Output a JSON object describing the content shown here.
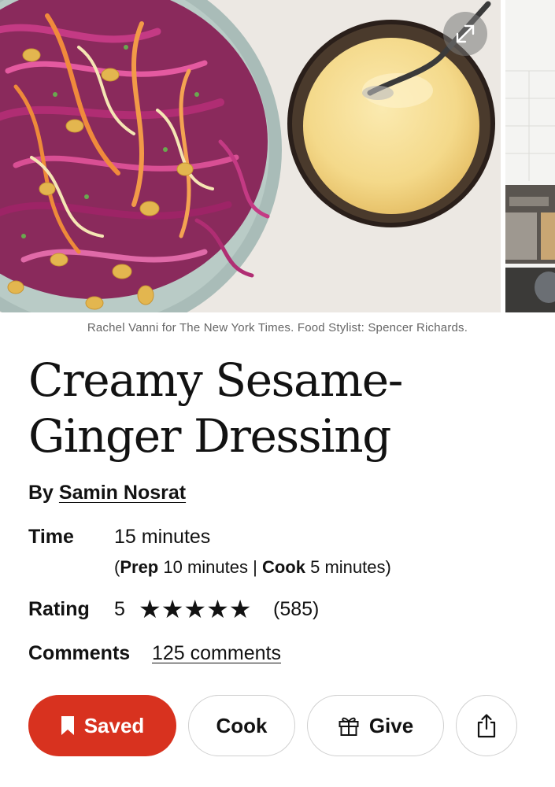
{
  "hero": {
    "credit": "Rachel Vanni for The New York Times. Food Stylist: Spencer Richards."
  },
  "recipe": {
    "title_line1": "Creamy Sesame-",
    "title_line2": "Ginger Dressing",
    "by_label": "By",
    "author": "Samin Nosrat",
    "time_label": "Time",
    "time_total": "15 minutes",
    "prep_label": "Prep",
    "prep_value": "10 minutes",
    "separator": "|",
    "cook_label": "Cook",
    "cook_value": "5 minutes",
    "rating_label": "Rating",
    "rating_value": "5",
    "rating_stars": 5,
    "rating_count": "(585)",
    "comments_label": "Comments",
    "comments_link": "125 comments"
  },
  "actions": {
    "saved_label": "Saved",
    "cook_label": "Cook",
    "give_label": "Give"
  },
  "icons": {
    "expand": "expand-icon",
    "bookmark": "bookmark-icon",
    "gift": "gift-icon",
    "share": "share-icon",
    "star": "star-icon"
  },
  "colors": {
    "saved_red": "#d8321f",
    "text": "#121212",
    "credit_gray": "#666666",
    "border": "#cfcfcf"
  }
}
